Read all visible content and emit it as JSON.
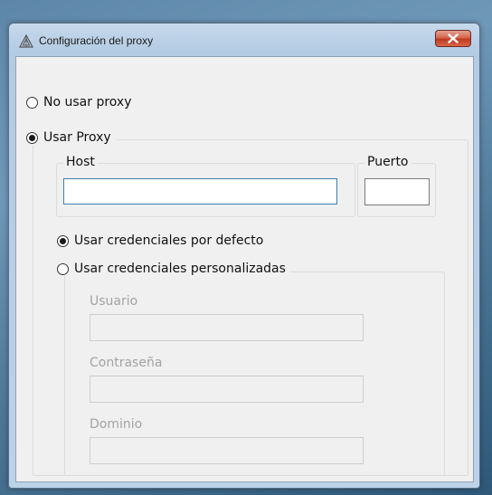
{
  "window": {
    "title": "Configuración del proxy",
    "close_symbol": "✕"
  },
  "proxy_mode": {
    "no_proxy_label": "No usar proxy",
    "use_proxy_label": "Usar Proxy",
    "selected": "use_proxy"
  },
  "host": {
    "label": "Host",
    "value": ""
  },
  "port": {
    "label": "Puerto",
    "value": ""
  },
  "credentials": {
    "default_label": "Usar credenciales por defecto",
    "custom_label": "Usar credenciales personalizadas",
    "selected": "default"
  },
  "custom_credentials": {
    "user_label": "Usuario",
    "user_value": "",
    "password_label": "Contraseña",
    "password_value": "",
    "domain_label": "Dominio",
    "domain_value": ""
  },
  "icons": {
    "title_icon": "proxy-app-icon",
    "close_icon": "close-icon"
  }
}
